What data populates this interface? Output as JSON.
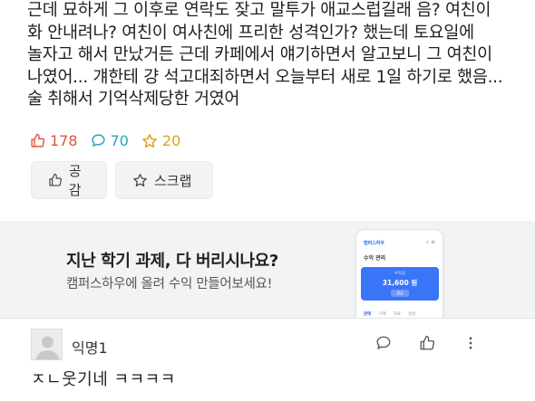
{
  "post": {
    "lines": [
      "근데 묘하게 그 이후로 연락도 잦고 말투가 애교스럽길래 음? 여친이",
      "화 안내려나? 여친이 여사친에 프리한 성격인가? 했는데 토요일에",
      "놀자고 해서 만났거든 근데 카페에서 얘기하면서 알고보니 그 여친이",
      "나였어... 걔한테 걍 석고대죄하면서 오늘부터 새로 1일 하기로 했음...",
      "술 취해서 기억삭제당한 거였어"
    ]
  },
  "stats": {
    "likes": "178",
    "comments": "70",
    "scraps": "20"
  },
  "actions": {
    "like_label": "공감",
    "scrap_label": "스크랩"
  },
  "ad": {
    "title": "지난 학기 과제, 다 버리시나요?",
    "subtitle": "캠퍼스하우에 올려 수익 만들어보세요!",
    "phone": {
      "brand": "캠퍼스하우",
      "heading": "수익 관리",
      "card_label": "수익금",
      "amount": "31,600 원",
      "card_button": "출금",
      "tabs": [
        "판매",
        "구매",
        "자료",
        "설정"
      ]
    }
  },
  "comment": {
    "author": "익명1",
    "text": "ㅈㄴ웃기네 ㅋㅋㅋㅋ"
  },
  "colors": {
    "like": "#e0533c",
    "comment": "#2aa3b8",
    "scrap": "#e0a317",
    "ad_background": "#f2f3f5",
    "ad_card": "#3a74f7"
  }
}
